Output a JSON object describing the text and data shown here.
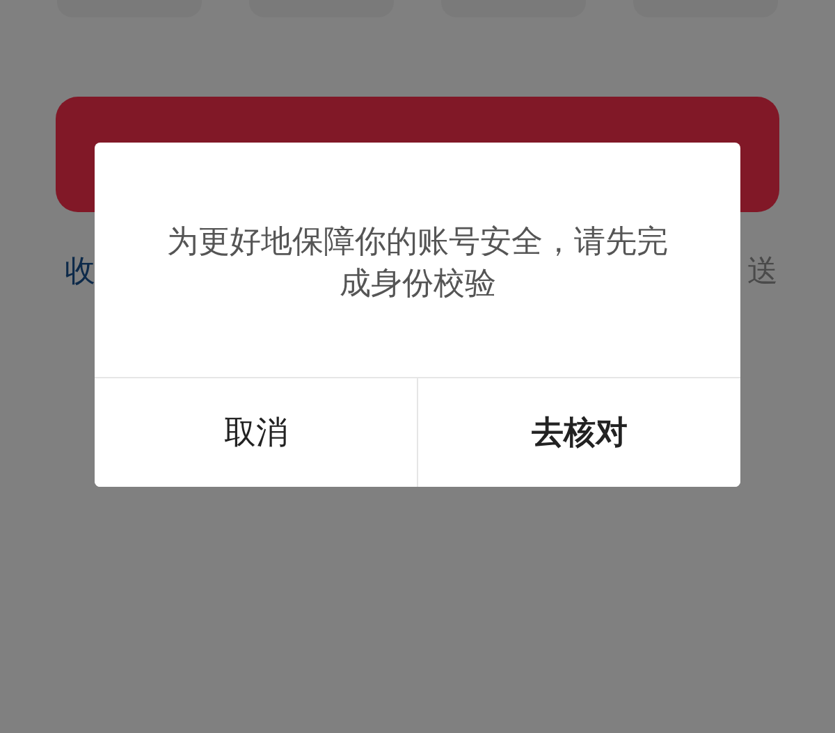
{
  "code_boxes": [
    {
      "kind": "box"
    },
    {
      "kind": "box"
    },
    {
      "kind": "box"
    },
    {
      "kind": "box"
    }
  ],
  "page": {
    "left_link": "收",
    "right_text": "送"
  },
  "dialog": {
    "message": "为更好地保障你的账号安全，请先完成身份校验",
    "buttons": [
      {
        "label": "取消",
        "kind": "secondary"
      },
      {
        "label": "去核对",
        "kind": "primary"
      }
    ]
  }
}
